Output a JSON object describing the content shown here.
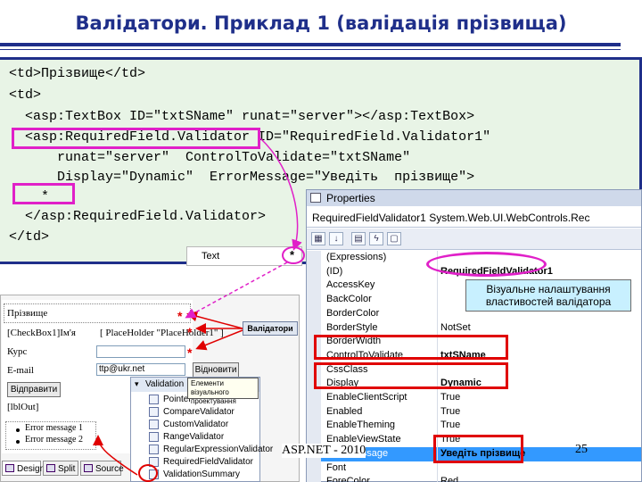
{
  "title": "Валідатори. Приклад 1 (валідація прізвища)",
  "code_lines": [
    "<td>Прізвище</td>",
    "<td>",
    "  <asp:TextBox ID=\"txtSName\" runat=\"server\"></asp:TextBox>",
    "  <asp:RequiredField.Validator ID=\"RequiredField.Validator1\"",
    "      runat=\"server\"  ControlToValidate=\"txtSName\"",
    "      Display=\"Dynamic\"  ErrorMessage=\"Уведіть  прізвище\">",
    "    *",
    "  </asp:RequiredField.Validator>",
    "</td>"
  ],
  "design_preview": {
    "textbox_text": "Text",
    "star": "*"
  },
  "properties": {
    "window_title": "Properties",
    "object_name": "RequiredFieldValidator1",
    "object_type": "System.Web.UI.WebControls.Rec",
    "rows": [
      {
        "name": "(Expressions)",
        "value": ""
      },
      {
        "name": "(ID)",
        "value": "RequiredFieldValidator1"
      },
      {
        "name": "AccessKey",
        "value": ""
      },
      {
        "name": "BackColor",
        "value": ""
      },
      {
        "name": "BorderColor",
        "value": ""
      },
      {
        "name": "BorderStyle",
        "value": "NotSet"
      },
      {
        "name": "BorderWidth",
        "value": ""
      },
      {
        "name": "ControlToValidate",
        "value": "txtSName"
      },
      {
        "name": "CssClass",
        "value": ""
      },
      {
        "name": "Display",
        "value": "Dynamic"
      },
      {
        "name": "EnableClientScript",
        "value": "True"
      },
      {
        "name": "Enabled",
        "value": "True"
      },
      {
        "name": "EnableTheming",
        "value": "True"
      },
      {
        "name": "EnableViewState",
        "value": "True"
      },
      {
        "name": "ErrorMessage",
        "value": "Уведіть прізвище"
      },
      {
        "name": "Font",
        "value": ""
      },
      {
        "name": "ForeColor",
        "value": "Red"
      }
    ]
  },
  "callout": "Візуальне налаштування властивостей валідатора",
  "designer": {
    "surname_label": "Прізвище",
    "row2_left": "[CheckBox1]Ім'я",
    "row2_right": "[ PlaceHolder \"PlaceHolder1\" ]",
    "course_label": "Курс",
    "email_label": "E-mail",
    "email_value": "ttp@ukr.net",
    "send_button": "Відновити",
    "submit_button": "Відправити",
    "lbl_out": "[lblOut]",
    "errors": [
      "Error message 1",
      "Error message 2"
    ],
    "validators_tag": "Валідатори",
    "tooltip": "Елементи візуального проектування"
  },
  "toolbox": {
    "header": "Validation",
    "items": [
      "Pointer",
      "CompareValidator",
      "CustomValidator",
      "RangeValidator",
      "RegularExpressionValidator",
      "RequiredFieldValidator",
      "ValidationSummary"
    ]
  },
  "view_tabs": [
    "Design",
    "Split",
    "Source"
  ],
  "footer": "ASP.NET - 2010",
  "page_number": "25",
  "colors": {
    "title": "#1f2f8a",
    "highlight_magenta": "#e020c8",
    "highlight_red": "#e00000",
    "code_background": "#e8f4e6",
    "callout_background": "#c8f0ff"
  }
}
